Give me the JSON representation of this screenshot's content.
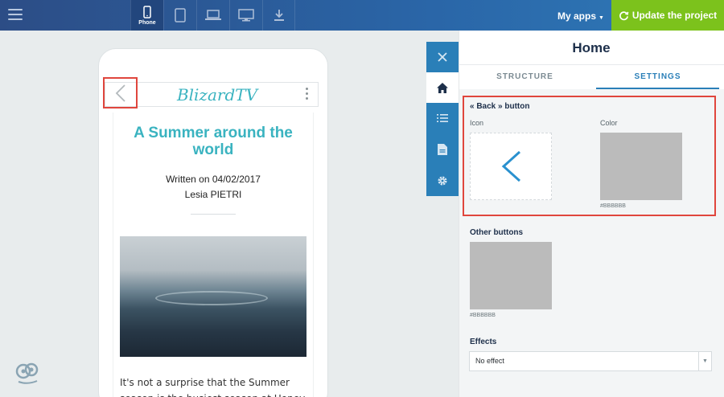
{
  "topbar": {
    "devices": [
      {
        "name": "phone",
        "label": "Phone",
        "active": true
      },
      {
        "name": "tablet",
        "label": "",
        "active": false
      },
      {
        "name": "laptop",
        "label": "",
        "active": false
      },
      {
        "name": "desktop",
        "label": "",
        "active": false
      },
      {
        "name": "download",
        "label": "",
        "active": false
      }
    ],
    "my_apps": "My apps",
    "update_label": "Update the project",
    "accent": "#7cc21c"
  },
  "preview": {
    "app_title": "BlizardTV",
    "article_title": "A Summer around the world",
    "written_on": "Written on 04/02/2017",
    "author": "Lesia PIETRI",
    "body": "It's not a surprise that the Summer season is the busiest season at Honey"
  },
  "panel": {
    "title": "Home",
    "tabs": [
      {
        "label": "STRUCTURE",
        "active": false
      },
      {
        "label": "SETTINGS",
        "active": true
      }
    ],
    "back_button": {
      "label": "« Back » button",
      "icon_label": "Icon",
      "color_label": "Color",
      "color_hex": "#BBBBBB"
    },
    "other_buttons": {
      "label": "Other buttons",
      "color_hex": "#BBBBBB"
    },
    "effects": {
      "label": "Effects",
      "value": "No effect"
    }
  },
  "colors": {
    "brand_teal": "#3ab3c0",
    "tool_blue": "#2a7fb8",
    "highlight_red": "#e0463d",
    "swatch": "#bbbbbb"
  }
}
